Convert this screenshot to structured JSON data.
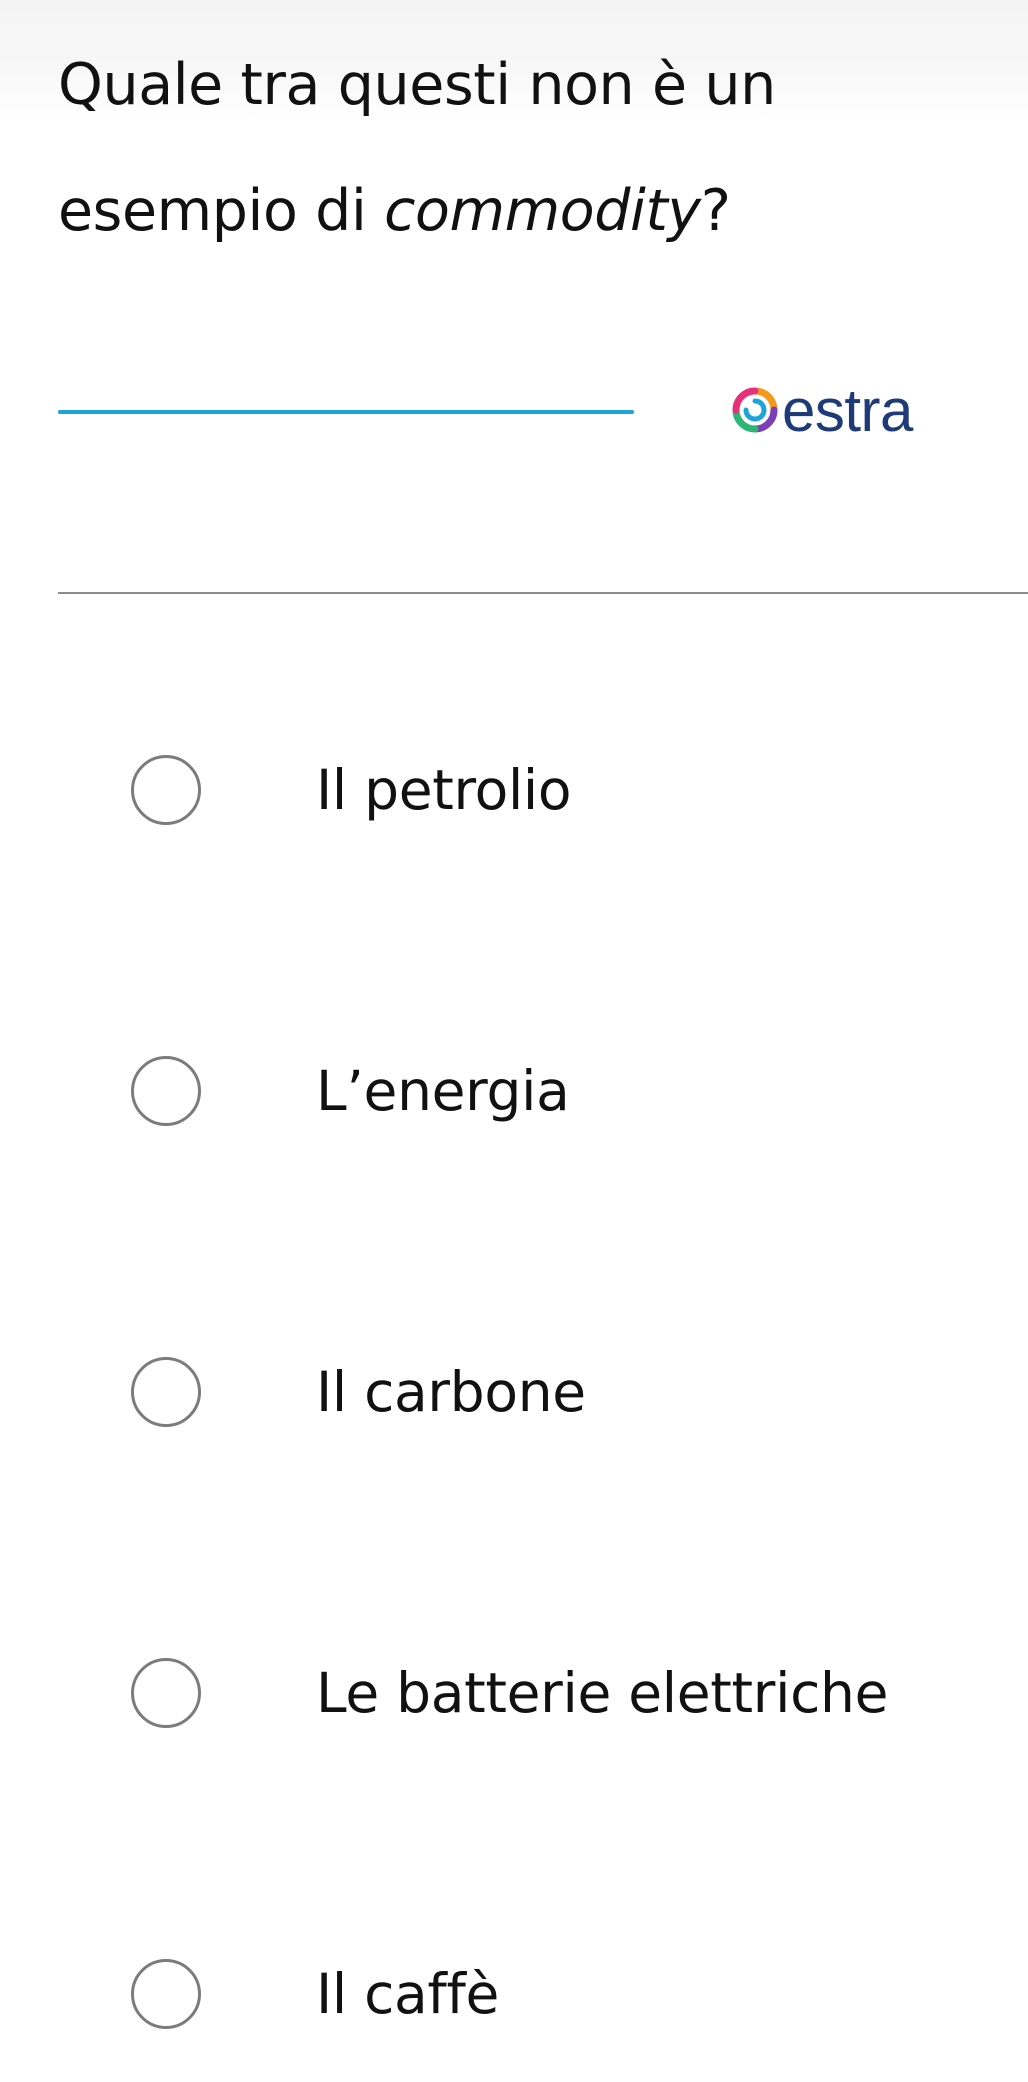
{
  "question": {
    "text_before": "Quale tra questi non è un esempio di ",
    "emphasis": "commodity",
    "text_after": "?"
  },
  "brand": {
    "name": "estra",
    "text_color": "#1e3a78",
    "accent_line_color": "#1ea4dc"
  },
  "options": [
    {
      "label": "Il petrolio",
      "selected": false
    },
    {
      "label": "L’energia",
      "selected": false
    },
    {
      "label": "Il carbone",
      "selected": false
    },
    {
      "label": "Le batterie elettriche",
      "selected": false
    },
    {
      "label": "Il caffè",
      "selected": false
    }
  ]
}
